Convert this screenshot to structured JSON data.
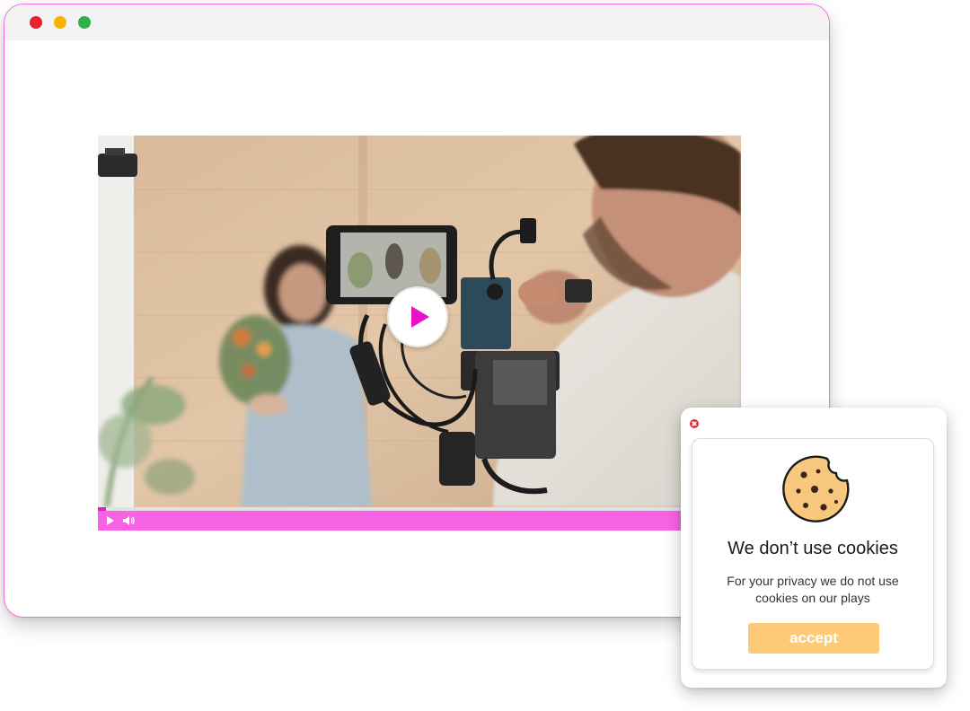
{
  "window": {
    "controls": {
      "close_color": "#e5232f",
      "minimize_color": "#f5b400",
      "maximize_color": "#2fb04a"
    },
    "border_color": "#f26fe0"
  },
  "video": {
    "progress": 0.012,
    "controls_color": "#f863e4",
    "play_icon": "play-icon",
    "volume_icon": "volume-icon"
  },
  "cookie_popup": {
    "icon": "cookie-icon",
    "title": "We don’t use cookies",
    "message": "For your privacy we do not use cookies on our plays",
    "accept_label": "accept",
    "accept_color": "#fdcb78"
  }
}
